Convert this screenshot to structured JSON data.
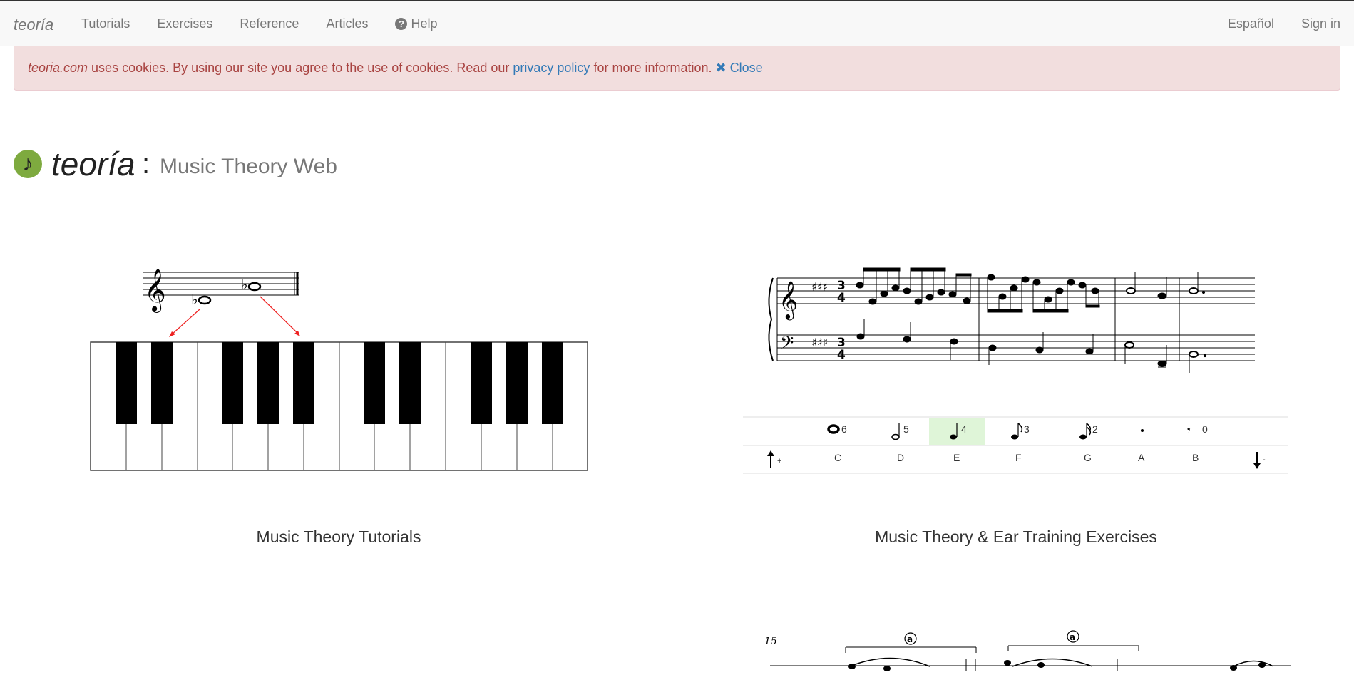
{
  "navbar": {
    "brand": "teoría",
    "items": [
      "Tutorials",
      "Exercises",
      "Reference",
      "Articles"
    ],
    "help": "Help",
    "right_items": [
      "Español",
      "Sign in"
    ]
  },
  "cookie": {
    "site": "teoria.com",
    "text_before": " uses cookies. By using our site you agree to the use of cookies. Read our ",
    "link": "privacy policy",
    "text_after": " for more information.",
    "close_icon": "✖",
    "close": "Close"
  },
  "header": {
    "logo_glyph": "♪",
    "title": "teoría",
    "colon": ":",
    "subtitle": "Music Theory Web"
  },
  "sections": {
    "tutorials": {
      "caption": "Music Theory Tutorials"
    },
    "exercises": {
      "caption": "Music Theory & Ear Training Exercises",
      "rhythm_keys": [
        "6",
        "5",
        "4",
        "3",
        "2",
        "",
        "0"
      ],
      "note_keys": [
        "+",
        "C",
        "D",
        "E",
        "F",
        "G",
        "A",
        "B",
        "-"
      ],
      "highlight_color": "#dff5d8"
    },
    "reference": {
      "measure_number": "15",
      "circle_marks": [
        "a",
        "a"
      ]
    }
  }
}
